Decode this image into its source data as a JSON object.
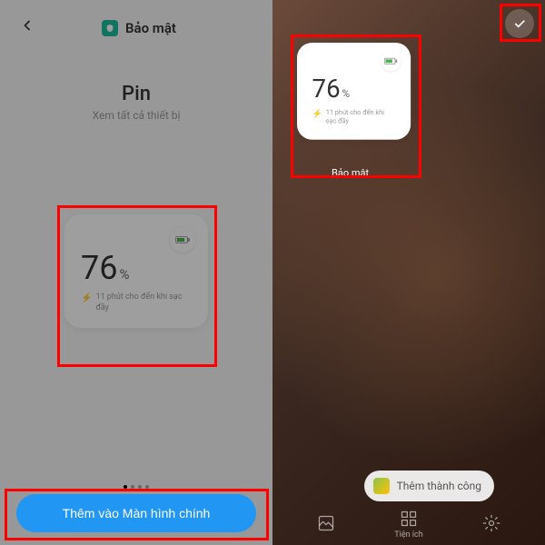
{
  "left": {
    "header_title": "Bảo mật",
    "pin_title": "Pin",
    "pin_subtitle": "Xem tất cả thiết bị",
    "widget": {
      "percent": "76",
      "percent_sign": "%",
      "charge_text": "11 phút cho đến khi sạc đầy"
    },
    "add_button": "Thêm vào Màn hình chính"
  },
  "right": {
    "widget": {
      "percent": "76",
      "percent_sign": "%",
      "charge_text": "11 phút cho đến khi sạc đầy",
      "label": "Bảo mật"
    },
    "toast": "Thêm thành công",
    "dock": {
      "utilities": "Tiện ích"
    }
  }
}
